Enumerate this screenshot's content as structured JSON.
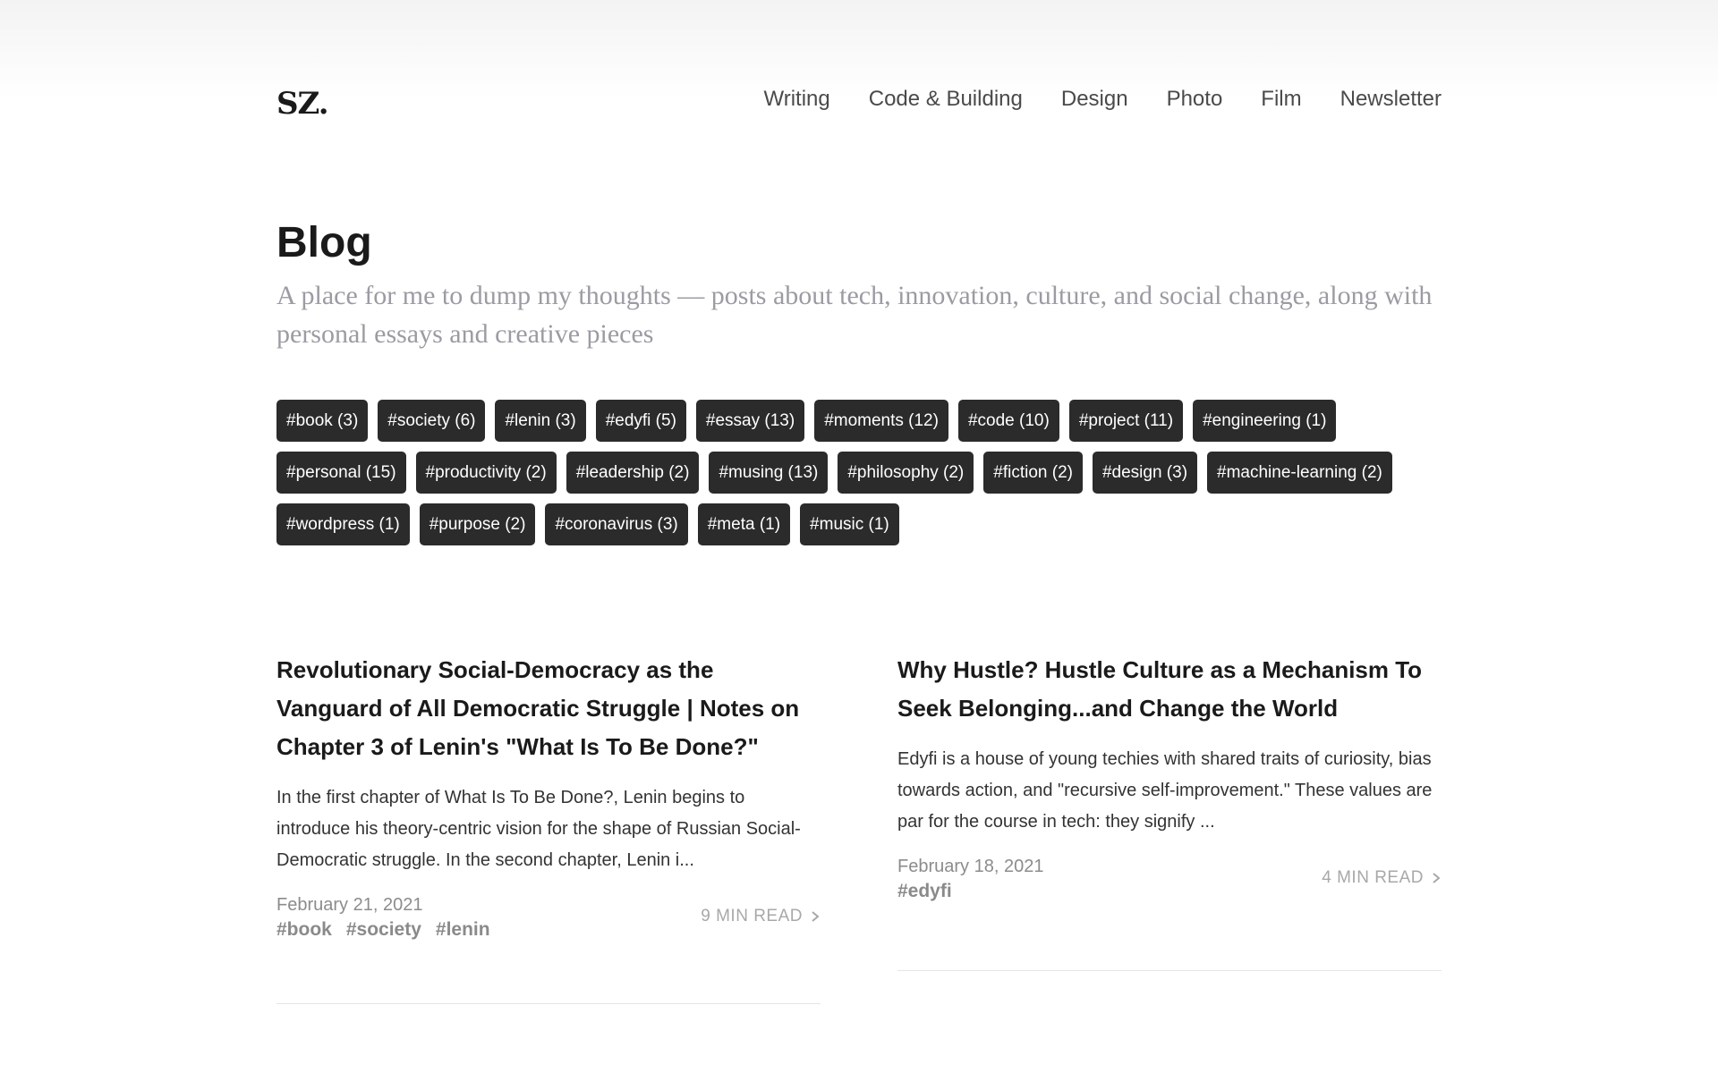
{
  "header": {
    "logo": "SZ.",
    "nav": [
      {
        "label": "Writing"
      },
      {
        "label": "Code & Building"
      },
      {
        "label": "Design"
      },
      {
        "label": "Photo"
      },
      {
        "label": "Film"
      },
      {
        "label": "Newsletter"
      }
    ]
  },
  "page": {
    "title": "Blog",
    "subtitle": "A place for me to dump my thoughts — posts about tech, innovation, culture, and social change, along with personal essays and creative pieces"
  },
  "tags": [
    "#book (3)",
    "#society (6)",
    "#lenin (3)",
    "#edyfi (5)",
    "#essay (13)",
    "#moments (12)",
    "#code (10)",
    "#project (11)",
    "#engineering (1)",
    "#personal (15)",
    "#productivity (2)",
    "#leadership (2)",
    "#musing (13)",
    "#philosophy (2)",
    "#fiction (2)",
    "#design (3)",
    "#machine-learning (2)",
    "#wordpress (1)",
    "#purpose (2)",
    "#coronavirus (3)",
    "#meta (1)",
    "#music (1)"
  ],
  "posts": [
    {
      "title": "Revolutionary Social-Democracy as the Vanguard of All Democratic Struggle | Notes on Chapter 3 of Lenin's \"What Is To Be Done?\"",
      "excerpt": "In the first chapter of What Is To Be Done?, Lenin begins to introduce his theory-centric vision for the shape of Russian Social-Democratic struggle. In the second chapter, Lenin i...",
      "date": "February 21, 2021",
      "tags": [
        "#book",
        "#society",
        "#lenin"
      ],
      "read_time": "9 MIN READ"
    },
    {
      "title": "Why Hustle? Hustle Culture as a Mechanism To Seek Belonging...and Change the World",
      "excerpt": "Edyfi is a house of young techies with shared traits of curiosity, bias towards action, and \"recursive self-improvement.\" These values are par for the course in tech: they signify ...",
      "date": "February 18, 2021",
      "tags": [
        "#edyfi"
      ],
      "read_time": "4 MIN READ"
    }
  ]
}
